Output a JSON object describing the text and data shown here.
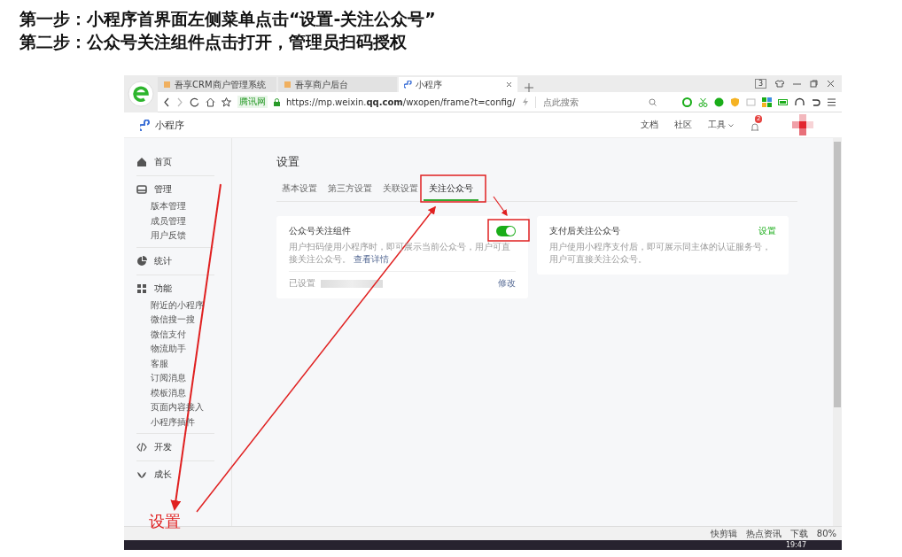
{
  "slide": {
    "lines": [
      "第一步：小程序首界面左侧菜单点击“设置-关注公众号”",
      "第二步：公众号关注组件点击打开，管理员扫码授权"
    ]
  },
  "browser": {
    "tabs": [
      {
        "title": "吾享CRM商户管理系统",
        "selected": false
      },
      {
        "title": "吾享商户后台",
        "selected": false
      },
      {
        "title": "小程序",
        "selected": true
      }
    ],
    "tab_count": "3",
    "site_badge": "腾讯网",
    "url": "https://mp.weixin.**qq.com**/wxopen/frame?t=config/",
    "search": {
      "placeholder": "点此搜索"
    }
  },
  "header": {
    "brand": "小程序",
    "links": [
      "文档",
      "社区",
      "工具"
    ],
    "notification_count": "2"
  },
  "sidebar": {
    "items": [
      {
        "label": "首页"
      },
      {
        "label": "管理",
        "children": [
          {
            "label": "版本管理"
          },
          {
            "label": "成员管理"
          },
          {
            "label": "用户反馈"
          }
        ]
      },
      {
        "label": "统计"
      },
      {
        "label": "功能",
        "children": [
          {
            "label": "附近的小程序"
          },
          {
            "label": "微信搜一搜"
          },
          {
            "label": "微信支付"
          },
          {
            "label": "物流助手"
          },
          {
            "label": "客服"
          },
          {
            "label": "订阅消息"
          },
          {
            "label": "模板消息"
          },
          {
            "label": "页面内容接入"
          },
          {
            "label": "小程序插件"
          }
        ]
      },
      {
        "label": "开发"
      },
      {
        "label": "成长"
      }
    ]
  },
  "page": {
    "title": "设置",
    "tabs": [
      {
        "label": "基本设置",
        "selected": false
      },
      {
        "label": "第三方设置",
        "selected": false
      },
      {
        "label": "关联设置",
        "selected": false
      },
      {
        "label": "关注公众号",
        "selected": true
      }
    ],
    "cards": [
      {
        "kind": "toggle",
        "title": "公众号关注组件",
        "on": true,
        "description": "用户扫码使用小程序时，即可展示当前公众号，用户可直接关注公众号。",
        "link": "查看详情",
        "footer_label": "已设置",
        "footer_action": "修改"
      },
      {
        "kind": "link",
        "title": "支付后关注公众号",
        "action": "设置",
        "description": "用户使用小程序支付后，即可展示同主体的认证服务号，用户可直接关注公众号。"
      }
    ]
  },
  "status_bar": {
    "items": [
      "快剪辑",
      "热点资讯",
      "下载",
      "80%"
    ]
  },
  "taskbar": {
    "time": "19:47"
  },
  "annotation": {
    "label": "设置"
  }
}
